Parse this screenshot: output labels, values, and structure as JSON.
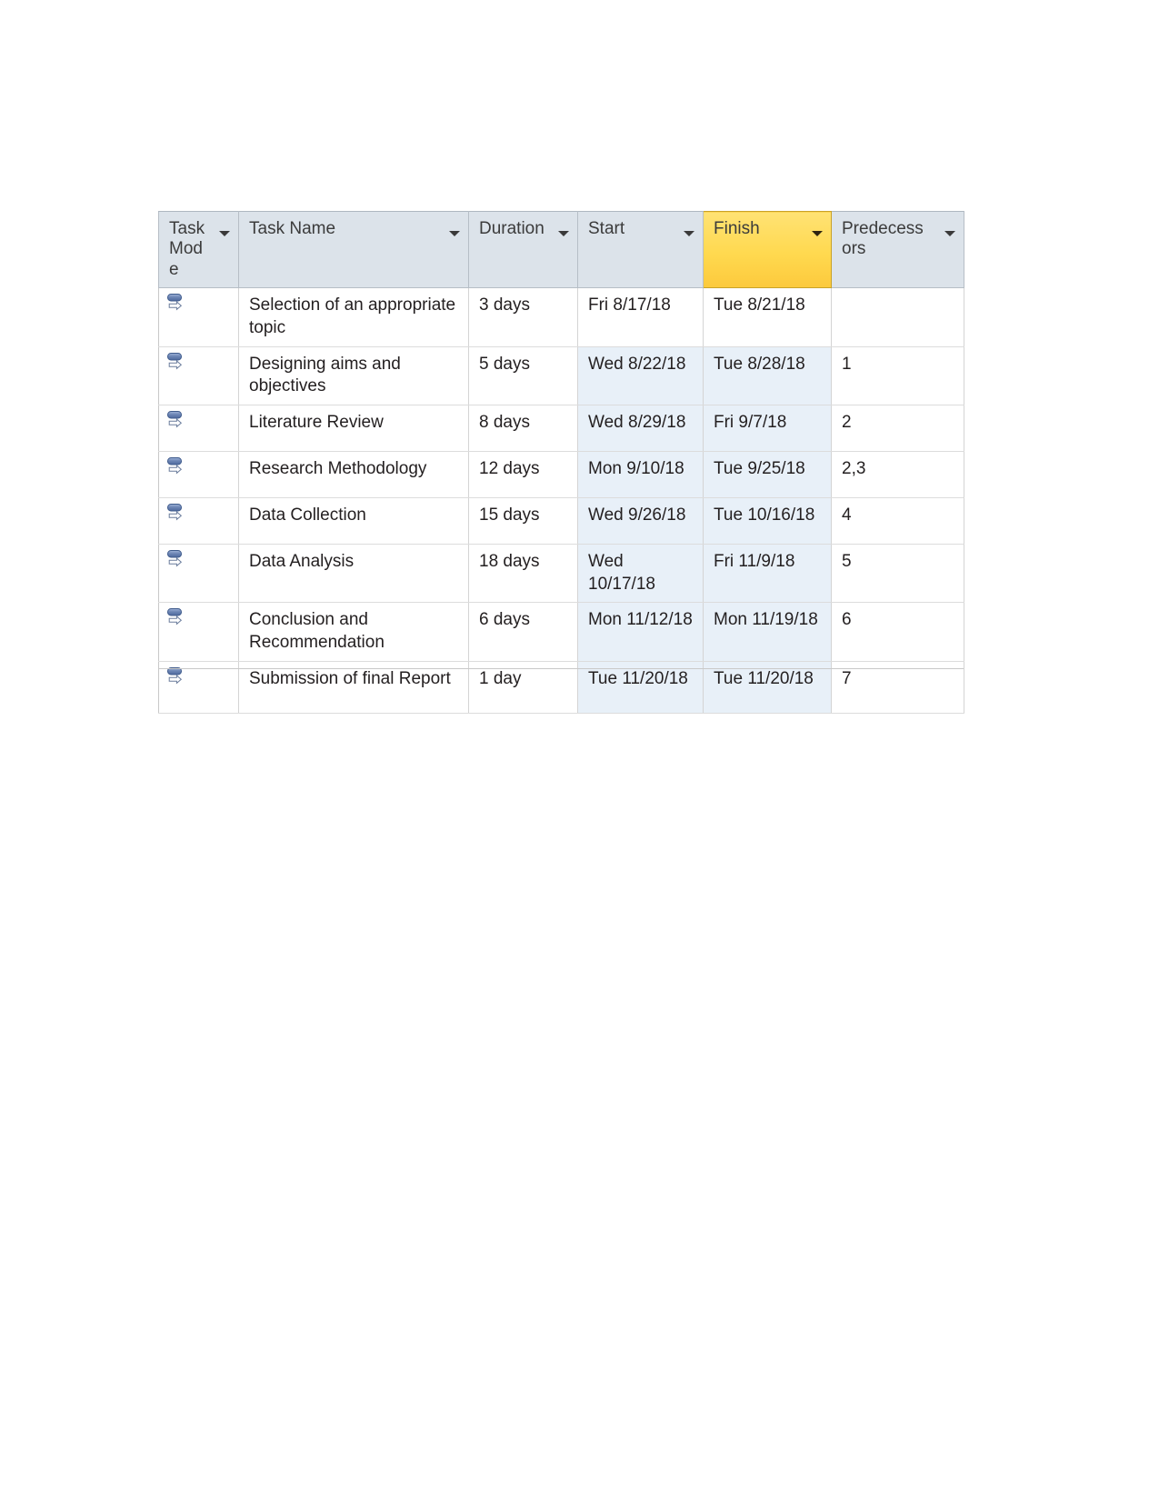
{
  "document": {
    "kind": "project-schedule-table",
    "background_color": "#ffffff"
  },
  "table": {
    "selected_column": "Finish",
    "colors": {
      "header_background": "#dce3ea",
      "selected_header_background": "#ffd94f",
      "date_column_tint": "#e8f0f8",
      "grid_line": "#d4d4d4",
      "text": "#231f20"
    },
    "columns": [
      {
        "key": "task_mode",
        "label": "Task Mode",
        "has_filter": true,
        "selected": false
      },
      {
        "key": "task_name",
        "label": "Task Name",
        "has_filter": true,
        "selected": false
      },
      {
        "key": "duration",
        "label": "Duration",
        "has_filter": true,
        "selected": false
      },
      {
        "key": "start",
        "label": "Start",
        "has_filter": true,
        "selected": false
      },
      {
        "key": "finish",
        "label": "Finish",
        "has_filter": true,
        "selected": true
      },
      {
        "key": "predecessors",
        "label": "Predecessors",
        "has_filter": true,
        "selected": false
      }
    ],
    "rows": [
      {
        "task_mode_icon": "auto-scheduled-icon",
        "task_name": "Selection of an appropriate topic",
        "duration": "3 days",
        "start": "Fri 8/17/18",
        "finish": "Tue 8/21/18",
        "predecessors": "",
        "tinted_dates": false,
        "two_line": true
      },
      {
        "task_mode_icon": "auto-scheduled-icon",
        "task_name": "Designing aims and objectives",
        "duration": "5 days",
        "start": "Wed 8/22/18",
        "finish": "Tue 8/28/18",
        "predecessors": "1",
        "tinted_dates": true,
        "two_line": true
      },
      {
        "task_mode_icon": "auto-scheduled-icon",
        "task_name": "Literature Review",
        "duration": "8 days",
        "start": "Wed 8/29/18",
        "finish": "Fri 9/7/18",
        "predecessors": "2",
        "tinted_dates": true,
        "two_line": false
      },
      {
        "task_mode_icon": "auto-scheduled-icon",
        "task_name": "Research Methodology",
        "duration": "12 days",
        "start": "Mon 9/10/18",
        "finish": "Tue 9/25/18",
        "predecessors": "2,3",
        "tinted_dates": true,
        "two_line": false
      },
      {
        "task_mode_icon": "auto-scheduled-icon",
        "task_name": "Data Collection",
        "duration": "15 days",
        "start": "Wed 9/26/18",
        "finish": "Tue 10/16/18",
        "predecessors": "4",
        "tinted_dates": true,
        "two_line": false
      },
      {
        "task_mode_icon": "auto-scheduled-icon",
        "task_name": "Data Analysis",
        "duration": "18 days",
        "start": "Wed 10/17/18",
        "finish": "Fri 11/9/18",
        "predecessors": "5",
        "tinted_dates": true,
        "two_line": false
      },
      {
        "task_mode_icon": "auto-scheduled-icon",
        "task_name": "Conclusion and Recommendation",
        "duration": "6 days",
        "start": "Mon 11/12/18",
        "finish": "Mon 11/19/18",
        "predecessors": "6",
        "tinted_dates": true,
        "two_line": true
      },
      {
        "task_mode_icon": "auto-scheduled-icon",
        "task_name": "Submission of final Report",
        "duration": "1 day",
        "start": "Tue 11/20/18",
        "finish": "Tue 11/20/18",
        "predecessors": "7",
        "tinted_dates": true,
        "two_line": true
      }
    ]
  }
}
